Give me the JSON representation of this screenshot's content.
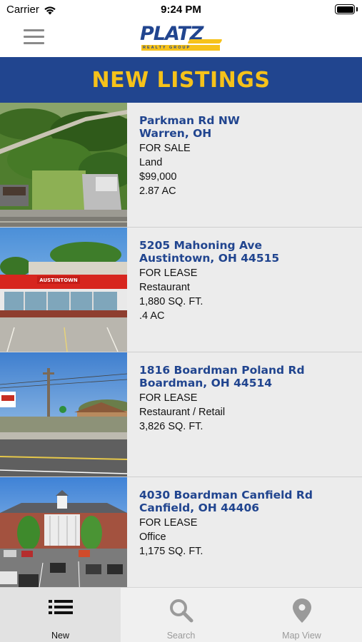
{
  "status_bar": {
    "carrier": "Carrier",
    "time": "9:24 PM",
    "icons": [
      "wifi-icon",
      "battery-icon"
    ]
  },
  "header": {
    "menu_icon": "hamburger-menu-icon",
    "logo_text": "PLATZ",
    "logo_subtext": "REALTY GROUP"
  },
  "banner": {
    "title": "NEW LISTINGS"
  },
  "colors": {
    "brand_blue": "#21458f",
    "brand_yellow": "#f6c21a",
    "list_background": "#ececec"
  },
  "listings": [
    {
      "address": "Parkman Rd NW",
      "city": "Warren, OH",
      "status": "FOR SALE",
      "type": "Land",
      "price": "$99,000",
      "size": "2.87 AC",
      "photo": "aerial-land-photo"
    },
    {
      "address": "5205 Mahoning Ave",
      "city": "Austintown, OH 44515",
      "status": "FOR LEASE",
      "type": "Restaurant",
      "size": "1,880 SQ. FT.",
      "acreage": ".4 AC",
      "photo": "restaurant-storefront-photo",
      "sign_text": "AUSTINTOWN"
    },
    {
      "address": "1816 Boardman Poland Rd",
      "city": "Boardman, OH 44514",
      "status": "FOR LEASE",
      "type": "Restaurant / Retail",
      "size": "3,826 SQ. FT.",
      "photo": "street-retail-photo"
    },
    {
      "address": "4030 Boardman Canfield Rd",
      "city": "Canfield, OH 44406",
      "status": "FOR LEASE",
      "type": "Office",
      "size": "1,175 SQ. FT.",
      "photo": "office-building-photo"
    }
  ],
  "tabbar": {
    "tabs": [
      {
        "label": "New",
        "icon": "list-icon",
        "active": true
      },
      {
        "label": "Search",
        "icon": "search-icon",
        "active": false
      },
      {
        "label": "Map View",
        "icon": "map-pin-icon",
        "active": false
      }
    ]
  }
}
